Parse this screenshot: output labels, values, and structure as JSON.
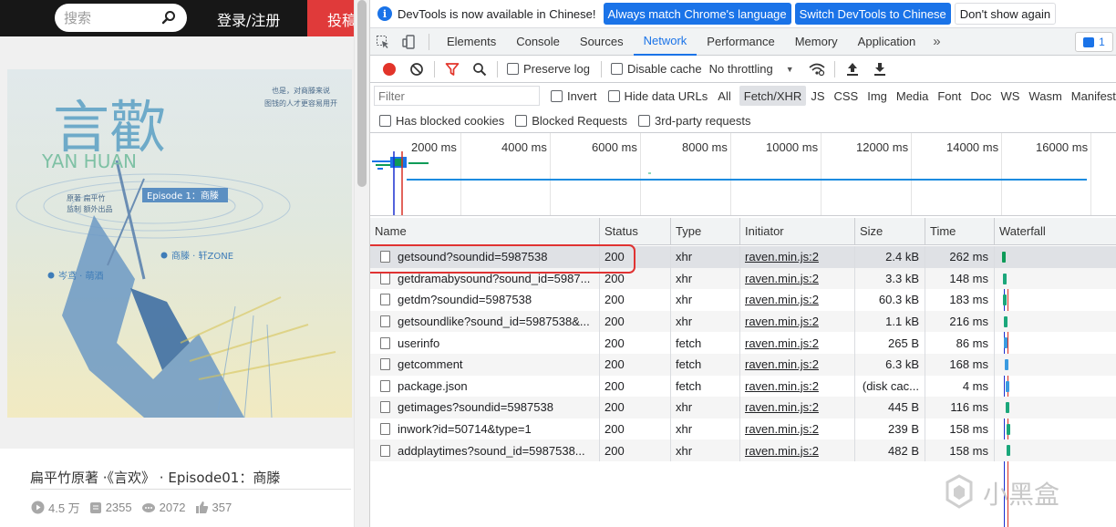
{
  "site": {
    "search_placeholder": "搜索",
    "login_label": "登录/注册",
    "submit_label": "投稿",
    "drama_title": "扁平竹原著 ·《言欢》 · Episode01：商滕",
    "stats": {
      "plays": "4.5 万",
      "comments": "2355",
      "danmaku": "2072",
      "likes": "357"
    },
    "cover": {
      "title_chars": "言歡",
      "pinyin": "YAN HUAN",
      "tagline_line1": "也是，对商滕来说",
      "tagline_line2": "图钱的人才更容易用开",
      "credit_line1": "原著  扁平竹",
      "credit_line2": "监制  额外出品",
      "episode": "Episode 1：商滕",
      "cast_left": "岑鸢 · 萌酒",
      "cast_right": "商滕 · 轩ZONE"
    }
  },
  "devtools": {
    "infobar": {
      "text": "DevTools is now available in Chinese!",
      "btn_match": "Always match Chrome's language",
      "btn_switch": "Switch DevTools to Chinese",
      "btn_dismiss": "Don't show again"
    },
    "tabs": [
      "Elements",
      "Console",
      "Sources",
      "Network",
      "Performance",
      "Memory",
      "Application"
    ],
    "active_tab": "Network",
    "more_tabs": "»",
    "issues_count": "1",
    "toolbar": {
      "preserve_log": "Preserve log",
      "disable_cache": "Disable cache",
      "throttling": "No throttling"
    },
    "filter": {
      "placeholder": "Filter",
      "invert": "Invert",
      "hide_data_urls": "Hide data URLs",
      "types": [
        "All",
        "Fetch/XHR",
        "JS",
        "CSS",
        "Img",
        "Media",
        "Font",
        "Doc",
        "WS",
        "Wasm",
        "Manifest"
      ],
      "selected_type": "Fetch/XHR",
      "has_blocked_cookies": "Has blocked cookies",
      "blocked_requests": "Blocked Requests",
      "third_party": "3rd-party requests"
    },
    "overview_ticks": [
      "2000 ms",
      "4000 ms",
      "6000 ms",
      "8000 ms",
      "10000 ms",
      "12000 ms",
      "14000 ms",
      "16000 ms"
    ],
    "columns": {
      "name": "Name",
      "status": "Status",
      "type": "Type",
      "initiator": "Initiator",
      "size": "Size",
      "time": "Time",
      "waterfall": "Waterfall"
    },
    "requests": [
      {
        "name": "getsound?soundid=5987538",
        "status": "200",
        "type": "xhr",
        "initiator": "raven.min.js:2",
        "size": "2.4 kB",
        "time": "262 ms",
        "wf_color": "#0d9b58"
      },
      {
        "name": "getdramabysound?sound_id=5987...",
        "status": "200",
        "type": "xhr",
        "initiator": "raven.min.js:2",
        "size": "3.3 kB",
        "time": "148 ms",
        "wf_color": "#1ba77b"
      },
      {
        "name": "getdm?soundid=5987538",
        "status": "200",
        "type": "xhr",
        "initiator": "raven.min.js:2",
        "size": "60.3 kB",
        "time": "183 ms",
        "wf_color": "#1ba77b"
      },
      {
        "name": "getsoundlike?sound_id=5987538&...",
        "status": "200",
        "type": "xhr",
        "initiator": "raven.min.js:2",
        "size": "1.1 kB",
        "time": "216 ms",
        "wf_color": "#1ba77b"
      },
      {
        "name": "userinfo",
        "status": "200",
        "type": "fetch",
        "initiator": "raven.min.js:2",
        "size": "265 B",
        "time": "86 ms",
        "wf_color": "#3c9be0"
      },
      {
        "name": "getcomment",
        "status": "200",
        "type": "fetch",
        "initiator": "raven.min.js:2",
        "size": "6.3 kB",
        "time": "168 ms",
        "wf_color": "#3c9be0"
      },
      {
        "name": "package.json",
        "status": "200",
        "type": "fetch",
        "initiator": "raven.min.js:2",
        "size": "(disk cac...",
        "time": "4 ms",
        "wf_color": "#3c9be0"
      },
      {
        "name": "getimages?soundid=5987538",
        "status": "200",
        "type": "xhr",
        "initiator": "raven.min.js:2",
        "size": "445 B",
        "time": "116 ms",
        "wf_color": "#1ba77b"
      },
      {
        "name": "inwork?id=50714&type=1",
        "status": "200",
        "type": "xhr",
        "initiator": "raven.min.js:2",
        "size": "239 B",
        "time": "158 ms",
        "wf_color": "#1ba77b"
      },
      {
        "name": "addplaytimes?sound_id=5987538...",
        "status": "200",
        "type": "xhr",
        "initiator": "raven.min.js:2",
        "size": "482 B",
        "time": "158 ms",
        "wf_color": "#1ba77b"
      }
    ],
    "selected_row": 0,
    "highlighted_row": 0
  },
  "watermark": "小黑盒"
}
